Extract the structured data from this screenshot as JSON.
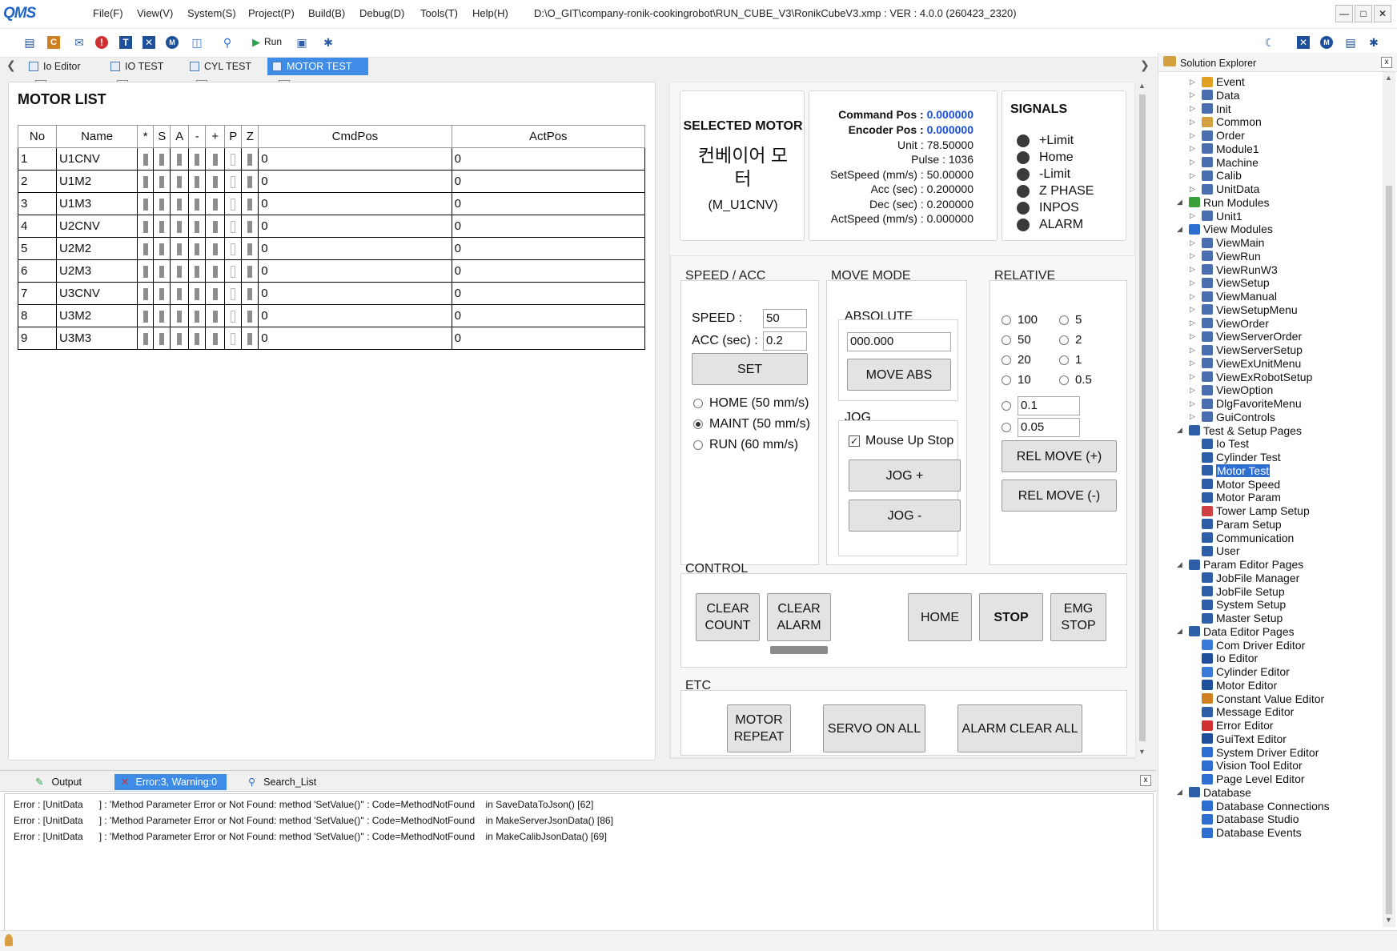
{
  "app": {
    "logo": "QMS",
    "title": "D:\\O_GIT\\company-ronik-cookingrobot\\RUN_CUBE_V3\\RonikCubeV3.xmp :  VER : 4.0.0 (260423_2320)"
  },
  "menu": [
    "File(F)",
    "View(V)",
    "System(S)",
    "Project(P)",
    "Build(B)",
    "Debug(D)",
    "Tools(T)",
    "Help(H)"
  ],
  "toolbar": {
    "run_label": "Run"
  },
  "tabs": [
    {
      "label": "Io Editor"
    },
    {
      "label": "IO TEST"
    },
    {
      "label": "CYL TEST"
    },
    {
      "label": "MOTOR TEST"
    }
  ],
  "tab_close": "x",
  "motor_list": {
    "title": "MOTOR LIST",
    "columns": [
      "No",
      "Name",
      "*",
      "S",
      "A",
      "-",
      "+",
      "P",
      "Z",
      "CmdPos",
      "ActPos"
    ],
    "rows": [
      {
        "no": "1",
        "name": "U1CNV",
        "flags": [
          1,
          1,
          1,
          1,
          1,
          0,
          1
        ],
        "cmd": "0",
        "act": "0"
      },
      {
        "no": "2",
        "name": "U1M2",
        "flags": [
          1,
          1,
          1,
          1,
          1,
          0,
          1
        ],
        "cmd": "0",
        "act": "0"
      },
      {
        "no": "3",
        "name": "U1M3",
        "flags": [
          1,
          1,
          1,
          1,
          1,
          0,
          1
        ],
        "cmd": "0",
        "act": "0"
      },
      {
        "no": "4",
        "name": "U2CNV",
        "flags": [
          1,
          1,
          1,
          1,
          1,
          0,
          1
        ],
        "cmd": "0",
        "act": "0"
      },
      {
        "no": "5",
        "name": "U2M2",
        "flags": [
          1,
          1,
          1,
          1,
          1,
          0,
          1
        ],
        "cmd": "0",
        "act": "0"
      },
      {
        "no": "6",
        "name": "U2M3",
        "flags": [
          1,
          1,
          1,
          1,
          1,
          0,
          1
        ],
        "cmd": "0",
        "act": "0"
      },
      {
        "no": "7",
        "name": "U3CNV",
        "flags": [
          1,
          1,
          1,
          1,
          1,
          0,
          1
        ],
        "cmd": "0",
        "act": "0"
      },
      {
        "no": "8",
        "name": "U3M2",
        "flags": [
          1,
          1,
          1,
          1,
          1,
          0,
          1
        ],
        "cmd": "0",
        "act": "0"
      },
      {
        "no": "9",
        "name": "U3M3",
        "flags": [
          1,
          1,
          1,
          1,
          1,
          0,
          1
        ],
        "cmd": "0",
        "act": "0"
      }
    ]
  },
  "selected": {
    "title": "SELECTED MOTOR",
    "name": "컨베이어 모터",
    "id": "(M_U1CNV)"
  },
  "info": {
    "cmd_label": "Command Pos : ",
    "cmd_value": "0.000000",
    "enc_label": "Encoder Pos : ",
    "enc_value": "0.000000",
    "unit": "Unit : 78.50000",
    "pulse": "Pulse : 1036",
    "setspeed": "SetSpeed (mm/s) : 50.00000",
    "acc": "Acc (sec) : 0.200000",
    "dec": "Dec (sec) : 0.200000",
    "actspeed": "ActSpeed (mm/s) : 0.000000",
    "value_color": "#1a4fd8"
  },
  "signals": {
    "title": "SIGNALS",
    "items": [
      "+Limit",
      "Home",
      "-Limit",
      "Z PHASE",
      "INPOS",
      "ALARM"
    ]
  },
  "speed": {
    "title": "SPEED / ACC",
    "speed_label": "SPEED :",
    "speed_value": "50",
    "acc_label": "ACC (sec) :",
    "acc_value": "0.2",
    "set": "SET",
    "modes": [
      "HOME (50 mm/s)",
      "MAINT (50 mm/s)",
      "RUN (60 mm/s)"
    ],
    "selected_mode": 1
  },
  "move": {
    "title": "MOVE MODE",
    "abs_title": "ABSOLUTE",
    "abs_value": "000.000",
    "move_abs": "MOVE ABS",
    "jog_title": "JOG",
    "mouse_up_stop": "Mouse Up Stop",
    "mouse_up_checked": true,
    "jog_plus": "JOG +",
    "jog_minus": "JOG -"
  },
  "relative": {
    "title": "RELATIVE",
    "left": [
      "100",
      "50",
      "20",
      "10"
    ],
    "right": [
      "5",
      "2",
      "1",
      "0.5"
    ],
    "custom1": "0.1",
    "custom2": "0.05",
    "rel_plus": "REL MOVE (+)",
    "rel_minus": "REL MOVE (-)"
  },
  "control": {
    "title": "CONTROL",
    "clear_count": "CLEAR COUNT",
    "clear_alarm": "CLEAR ALARM",
    "home": "HOME",
    "stop": "STOP",
    "emg_stop": "EMG STOP"
  },
  "etc": {
    "title": "ETC",
    "motor_repeat": "MOTOR REPEAT",
    "servo_on_all": "SERVO ON ALL",
    "alarm_clear_all": "ALARM CLEAR ALL"
  },
  "output": {
    "tabs": [
      "Output",
      "Error:3, Warning:0",
      "Search_List"
    ],
    "close": "x",
    "lines": [
      "Error : [UnitData      ] : 'Method Parameter Error or Not Found: method 'SetValue()'' : Code=MethodNotFound    in SaveDataToJson() [62]",
      "Error : [UnitData      ] : 'Method Parameter Error or Not Found: method 'SetValue()'' : Code=MethodNotFound    in MakeServerJsonData() [86]",
      "Error : [UnitData      ] : 'Method Parameter Error or Not Found: method 'SetValue()'' : Code=MethodNotFound    in MakeCalibJsonData() [69]"
    ]
  },
  "explorer": {
    "title": "Solution Explorer",
    "close": "x",
    "items": [
      {
        "label": "Event",
        "level": 2,
        "color": "#e0a020"
      },
      {
        "label": "Data",
        "level": 2,
        "color": "#4a6fb0"
      },
      {
        "label": "Init",
        "level": 2,
        "color": "#4a6fb0"
      },
      {
        "label": "Common",
        "level": 2,
        "color": "#d4a040"
      },
      {
        "label": "Order",
        "level": 2,
        "color": "#4a6fb0"
      },
      {
        "label": "Module1",
        "level": 2,
        "color": "#4a6fb0"
      },
      {
        "label": "Machine",
        "level": 2,
        "color": "#4a6fb0"
      },
      {
        "label": "Calib",
        "level": 2,
        "color": "#4a6fb0"
      },
      {
        "label": "UnitData",
        "level": 2,
        "color": "#4a6fb0"
      },
      {
        "label": "Run Modules",
        "level": 1,
        "color": "#3aa03a"
      },
      {
        "label": "Unit1",
        "level": 2,
        "color": "#4a6fb0"
      },
      {
        "label": "View Modules",
        "level": 1,
        "color": "#2d6ed0"
      },
      {
        "label": "ViewMain",
        "level": 2,
        "color": "#4a6fb0"
      },
      {
        "label": "ViewRun",
        "level": 2,
        "color": "#4a6fb0"
      },
      {
        "label": "ViewRunW3",
        "level": 2,
        "color": "#4a6fb0"
      },
      {
        "label": "ViewSetup",
        "level": 2,
        "color": "#4a6fb0"
      },
      {
        "label": "ViewManual",
        "level": 2,
        "color": "#4a6fb0"
      },
      {
        "label": "ViewSetupMenu",
        "level": 2,
        "color": "#4a6fb0"
      },
      {
        "label": "ViewOrder",
        "level": 2,
        "color": "#4a6fb0"
      },
      {
        "label": "ViewServerOrder",
        "level": 2,
        "color": "#4a6fb0"
      },
      {
        "label": "ViewServerSetup",
        "level": 2,
        "color": "#4a6fb0"
      },
      {
        "label": "ViewExUnitMenu",
        "level": 2,
        "color": "#4a6fb0"
      },
      {
        "label": "ViewExRobotSetup",
        "level": 2,
        "color": "#4a6fb0"
      },
      {
        "label": "ViewOption",
        "level": 2,
        "color": "#4a6fb0"
      },
      {
        "label": "DlgFavoriteMenu",
        "level": 2,
        "color": "#4a6fb0"
      },
      {
        "label": "GuiControls",
        "level": 2,
        "color": "#4a6fb0"
      },
      {
        "label": "Test & Setup Pages",
        "level": 1,
        "color": "#2d5fa8"
      },
      {
        "label": "Io Test",
        "level": 2,
        "color": "#2d5fa8"
      },
      {
        "label": "Cylinder Test",
        "level": 2,
        "color": "#2d5fa8"
      },
      {
        "label": "Motor Test",
        "level": 2,
        "color": "#2d5fa8",
        "selected": true
      },
      {
        "label": "Motor Speed",
        "level": 2,
        "color": "#2d5fa8"
      },
      {
        "label": "Motor Param",
        "level": 2,
        "color": "#2d5fa8"
      },
      {
        "label": "Tower Lamp Setup",
        "level": 2,
        "color": "#d04040"
      },
      {
        "label": "Param Setup",
        "level": 2,
        "color": "#2d5fa8"
      },
      {
        "label": "Communication",
        "level": 2,
        "color": "#2d5fa8"
      },
      {
        "label": "User",
        "level": 2,
        "color": "#2d5fa8"
      },
      {
        "label": "Param Editor Pages",
        "level": 1,
        "color": "#2d5fa8"
      },
      {
        "label": "JobFile Manager",
        "level": 2,
        "color": "#2d5fa8"
      },
      {
        "label": "JobFile Setup",
        "level": 2,
        "color": "#2d5fa8"
      },
      {
        "label": "System Setup",
        "level": 2,
        "color": "#2d5fa8"
      },
      {
        "label": "Master Setup",
        "level": 2,
        "color": "#2d5fa8"
      },
      {
        "label": "Data Editor Pages",
        "level": 1,
        "color": "#2d5fa8"
      },
      {
        "label": "Com Driver Editor",
        "level": 2,
        "color": "#3a7ad8"
      },
      {
        "label": "Io Editor",
        "level": 2,
        "color": "#1d4f9a"
      },
      {
        "label": "Cylinder Editor",
        "level": 2,
        "color": "#3a7ad8"
      },
      {
        "label": "Motor Editor",
        "level": 2,
        "color": "#1d4f9a"
      },
      {
        "label": "Constant Value Editor",
        "level": 2,
        "color": "#d08020"
      },
      {
        "label": "Message Editor",
        "level": 2,
        "color": "#2d5fa8"
      },
      {
        "label": "Error Editor",
        "level": 2,
        "color": "#d03030"
      },
      {
        "label": "GuiText Editor",
        "level": 2,
        "color": "#1d4f9a"
      },
      {
        "label": "System Driver Editor",
        "level": 2,
        "color": "#2d6ed0"
      },
      {
        "label": "Vision Tool Editor",
        "level": 2,
        "color": "#2d6ed0"
      },
      {
        "label": "Page Level Editor",
        "level": 2,
        "color": "#2d6ed0"
      },
      {
        "label": "Database",
        "level": 1,
        "color": "#2d5fa8"
      },
      {
        "label": "Database Connections",
        "level": 2,
        "color": "#2d6ed0"
      },
      {
        "label": "Database Studio",
        "level": 2,
        "color": "#2d6ed0"
      },
      {
        "label": "Database Events",
        "level": 2,
        "color": "#2d6ed0"
      }
    ]
  }
}
